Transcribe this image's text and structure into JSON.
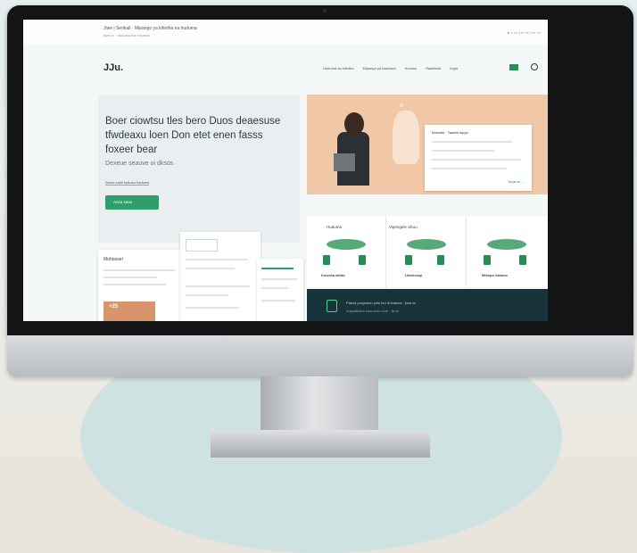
{
  "browser": {
    "title": "Jiwe | Serikali · Mipango ya kifedha na huduma",
    "url": "jiwe.co · ukurasa wa mwanzo",
    "status": "● ▪ ▪▪ ▪▪▪ ▪▪ ▪▪▪ ▪▪"
  },
  "nav": {
    "logo": "JJu.",
    "items": [
      "Huduma za kifedha",
      "Mipango ya biashara",
      "Kuhusu",
      "Rasilimali",
      "Ingia"
    ]
  },
  "hero": {
    "headline": "Boer ciowtsu tles bero Duos deaesuse tfwdeaxu loen Don etet enen fasss foxeer bear",
    "subheading": "Dexeue seauve oi dksos",
    "link": "Soma zaidi kuhusu huduma",
    "cta": "Anza sasa"
  },
  "cards": {
    "card1_label": "Muhtasari",
    "card1_badge": "+25"
  },
  "popup": {
    "title": "Maombi · Taarifa mpya",
    "action": "Tazama →"
  },
  "features": {
    "heading_left": "Huduma",
    "heading_right": "Vipengele vikuu",
    "labels": [
      "Kuweka akiba",
      "Uwekezaji",
      "Mikopo salama"
    ]
  },
  "banner": {
    "line1": "Pakua programu yetu leo ili kuanza · jiwe.co",
    "line2": "Inapatikana kwa simu zote · Bure"
  },
  "colors": {
    "accent": "#2f9e6a",
    "dark_banner": "#18343a",
    "hero_photo_bg": "#f0c8a8"
  }
}
